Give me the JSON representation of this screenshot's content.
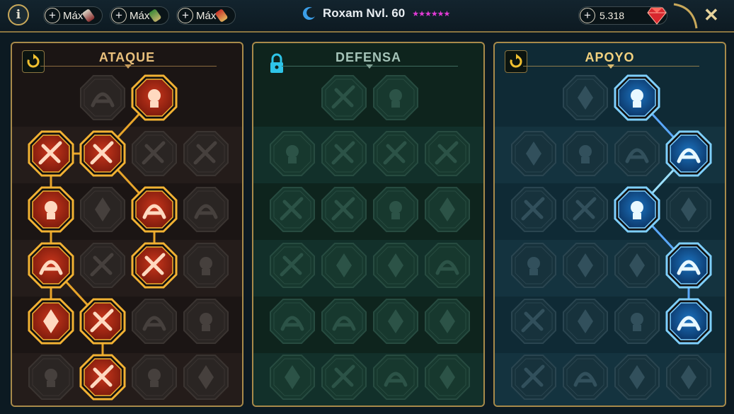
{
  "topbar": {
    "info_label": "i",
    "resources": [
      {
        "label": "Máx",
        "plus": "+",
        "scroll_colors": [
          "#d9d3c4",
          "#8a2f2f"
        ]
      },
      {
        "label": "Máx",
        "plus": "+",
        "scroll_colors": [
          "#3f8a3a",
          "#c3b26a"
        ]
      },
      {
        "label": "Máx",
        "plus": "+",
        "scroll_colors": [
          "#c8342c",
          "#e0b25a"
        ]
      }
    ],
    "affinity_icon": "blue-crescent-icon",
    "champion": "Roxam Nvl. 60",
    "stars": "★★★★★★",
    "gems": {
      "plus": "+",
      "amount": "5.318",
      "icon": "red-gem-icon"
    },
    "close_label": "✕"
  },
  "colors": {
    "attack": "#e0481f",
    "attack_glow": "#f2b233",
    "support": "#1e8ed6",
    "support_glow": "#9de2ff",
    "gold": "#a88a4a"
  },
  "trees": [
    {
      "key": "atk",
      "title": "ATAQUE",
      "header_icon": "reset-icon",
      "nodes": [
        [
          {
            "state": "locked",
            "icon": "crossed-swords-icon"
          },
          {
            "state": "active",
            "icon": "blade-slash-icon"
          }
        ],
        [
          {
            "state": "active",
            "icon": "horned-demon-icon"
          },
          {
            "state": "active",
            "icon": "sword-strike-icon"
          },
          {
            "state": "locked",
            "icon": "shield-arrow-icon"
          },
          {
            "state": "locked",
            "icon": "shield-heart-icon"
          }
        ],
        [
          {
            "state": "active",
            "icon": "fist-arrows-icon"
          },
          {
            "state": "locked",
            "icon": "fangs-icon"
          },
          {
            "state": "active",
            "icon": "skull-claw-icon"
          },
          {
            "state": "locked",
            "icon": "scythe-icon"
          }
        ],
        [
          {
            "state": "active",
            "icon": "drop-blade-icon"
          },
          {
            "state": "locked",
            "icon": "gauntlet-icon"
          },
          {
            "state": "active",
            "icon": "axe-chop-icon"
          },
          {
            "state": "locked",
            "icon": "chain-lightning-icon"
          }
        ],
        [
          {
            "state": "active",
            "icon": "arrows-target-icon"
          },
          {
            "state": "active",
            "icon": "triple-skull-icon"
          },
          {
            "state": "locked",
            "icon": "shield-icon"
          },
          {
            "state": "locked",
            "icon": "warrior-icon"
          }
        ],
        [
          {
            "state": "locked",
            "icon": "sword-swing-icon"
          },
          {
            "state": "active",
            "icon": "flaming-helm-icon"
          },
          {
            "state": "locked",
            "icon": "demon-wings-icon"
          },
          {
            "state": "locked",
            "icon": "spartan-skull-icon"
          }
        ]
      ]
    },
    {
      "key": "def",
      "title": "DEFENSA",
      "header_icon": "lock-icon",
      "nodes": [
        [
          {
            "state": "locked",
            "icon": "brick-shield-icon"
          },
          {
            "state": "locked",
            "icon": "raised-fist-icon"
          }
        ],
        [
          {
            "state": "locked",
            "icon": "wing-shield-icon"
          },
          {
            "state": "locked",
            "icon": "bird-icon"
          },
          {
            "state": "locked",
            "icon": "warrior-bust-icon"
          },
          {
            "state": "locked",
            "icon": "broken-sword-icon"
          }
        ],
        [
          {
            "state": "locked",
            "icon": "shield-plate-icon"
          },
          {
            "state": "locked",
            "icon": "cloak-figure-icon"
          },
          {
            "state": "locked",
            "icon": "heart-beast-icon"
          },
          {
            "state": "locked",
            "icon": "rage-face-icon"
          }
        ],
        [
          {
            "state": "locked",
            "icon": "twin-figures-icon"
          },
          {
            "state": "locked",
            "icon": "hourglass-icon"
          },
          {
            "state": "locked",
            "icon": "open-hand-icon"
          },
          {
            "state": "locked",
            "icon": "bull-skull-icon"
          }
        ],
        [
          {
            "state": "locked",
            "icon": "running-strike-icon"
          },
          {
            "state": "locked",
            "icon": "rain-drops-icon"
          },
          {
            "state": "locked",
            "icon": "skull-icon"
          },
          {
            "state": "locked",
            "icon": "boomerang-icon"
          }
        ],
        [
          {
            "state": "locked",
            "icon": "titan-icon"
          },
          {
            "state": "locked",
            "icon": "sword-shield-icon"
          },
          {
            "state": "locked",
            "icon": "helmet-icon"
          },
          {
            "state": "locked",
            "icon": "shield-knight-icon"
          }
        ]
      ]
    },
    {
      "key": "sup",
      "title": "APOYO",
      "header_icon": "reset-icon",
      "nodes": [
        [
          {
            "state": "locked",
            "icon": "heart-sparkle-icon"
          },
          {
            "state": "active",
            "icon": "cyclone-icon"
          }
        ],
        [
          {
            "state": "locked",
            "icon": "praying-hands-icon"
          },
          {
            "state": "locked",
            "icon": "shield-ring-icon"
          },
          {
            "state": "locked",
            "icon": "skull-fire-icon"
          },
          {
            "state": "active",
            "icon": "speed-hand-icon"
          }
        ],
        [
          {
            "state": "locked",
            "icon": "mage-icon"
          },
          {
            "state": "locked",
            "icon": "lightning-shield-icon"
          },
          {
            "state": "active",
            "icon": "shatter-icon"
          },
          {
            "state": "locked",
            "icon": "giant-icon"
          }
        ],
        [
          {
            "state": "locked",
            "icon": "chain-heart-icon"
          },
          {
            "state": "locked",
            "icon": "comet-icon"
          },
          {
            "state": "locked",
            "icon": "spellbook-icon"
          },
          {
            "state": "active",
            "icon": "angry-eyes-icon"
          }
        ],
        [
          {
            "state": "locked",
            "icon": "compass-star-icon"
          },
          {
            "state": "locked",
            "icon": "dash-boot-icon"
          },
          {
            "state": "locked",
            "icon": "eye-icon"
          },
          {
            "state": "active",
            "icon": "dancing-figure-icon"
          }
        ],
        [
          {
            "state": "locked",
            "icon": "bomb-icon"
          },
          {
            "state": "locked",
            "icon": "skull-helm-icon"
          },
          {
            "state": "locked",
            "icon": "clenched-fist-icon"
          },
          {
            "state": "locked",
            "icon": "eagle-icon"
          }
        ]
      ]
    }
  ]
}
